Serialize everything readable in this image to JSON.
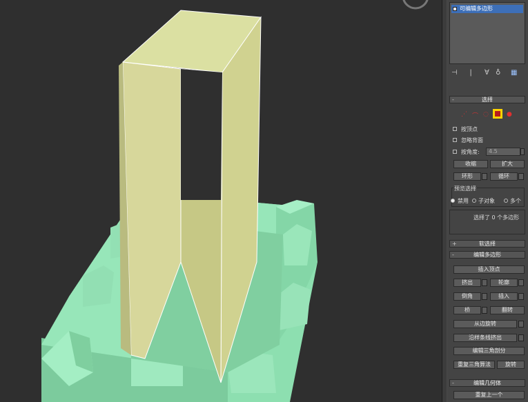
{
  "stack": {
    "modifier_label": "可编辑多边形"
  },
  "toolbar_icons": [
    "pin-icon",
    "separator",
    "show-end-result-icon",
    "make-unique-icon",
    "remove-modifier-icon",
    "configure-sets-icon"
  ],
  "selection": {
    "title": "选择",
    "collapse_symbol": "-",
    "by_vertex": "按顶点",
    "ignore_backfacing": "忽略背面",
    "by_angle": "按角度:",
    "angle_value": "4.5",
    "shrink": "收缩",
    "grow": "扩大",
    "ring": "环形",
    "loop": "循环",
    "preview_title": "预览选择",
    "preview_off": "禁用",
    "preview_subobject": "子对象",
    "preview_multi": "多个",
    "status": "选择了 0 个多边形"
  },
  "soft_selection": {
    "title": "软选择",
    "expand_symbol": "+"
  },
  "edit_polygons": {
    "title": "编辑多边形",
    "collapse_symbol": "-",
    "insert_vertex": "插入顶点",
    "extrude": "挤出",
    "outline": "轮廓",
    "bevel": "倒角",
    "inset": "插入",
    "bridge": "桥",
    "flip": "翻转",
    "hinge_from_edge": "从边旋转",
    "extrude_along_spline": "沿样条线挤出",
    "edit_triangulation": "编辑三角剖分",
    "retriangulate": "重复三角算法",
    "turn": "旋转"
  },
  "edit_geometry": {
    "title": "编辑几何体",
    "collapse_symbol": "-",
    "repeat_last": "重复上一个"
  },
  "colors": {
    "viewport_bg": "#2f2f2f",
    "selected_face": "#d9dc9e",
    "geometry": "#8edfb2",
    "panel_bg": "#444444",
    "highlight": "#3d6fb8",
    "active_mode": "#ffd400"
  }
}
